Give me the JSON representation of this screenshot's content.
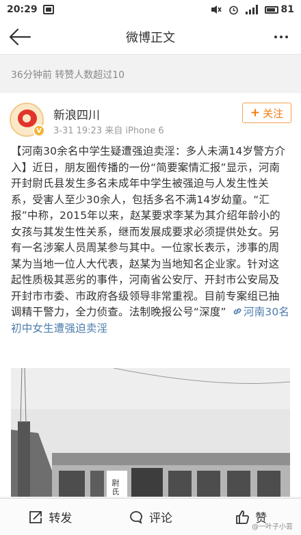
{
  "status_bar": {
    "time": "20:29",
    "battery": "81"
  },
  "nav": {
    "title": "微博正文"
  },
  "meta_line": "36分钟前  转赞人数超过10",
  "post": {
    "user_name": "新浪四川",
    "meta": "3-31 19:23  来自 iPhone 6",
    "follow_label": "关注",
    "body": "【河南30余名中学生疑遭强迫卖淫：多人未满14岁警方介入】近日，朋友圈传播的一份“简要案情汇报”显示，河南开封尉氏县发生多名未成年中学生被强迫与人发生性关系，受害人至少30余人，包括多名不满14岁幼童。“汇报”中称，2015年以来，赵某要求李某为其介绍年龄小的女孩与其发生性关系，继而发展成要求必须提供处女。另有一名涉案人员周某参与其中。一位家长表示，涉事的周某为当地一位人大代表，赵某为当地知名企业家。针对这起性质极其恶劣的事件，河南省公安厅、开封市公安局及开封市市委、市政府各级领导非常重视。目前专案组已抽调精干警力，全力侦查。法制晚报公号“深度”",
    "topic_link": "河南30名初中女生遭强迫卖淫",
    "photo_signage": "尉氏"
  },
  "toolbar": {
    "repost": "转发",
    "comment": "评论",
    "like": "赞"
  },
  "watermark": "@一叶子小芸"
}
